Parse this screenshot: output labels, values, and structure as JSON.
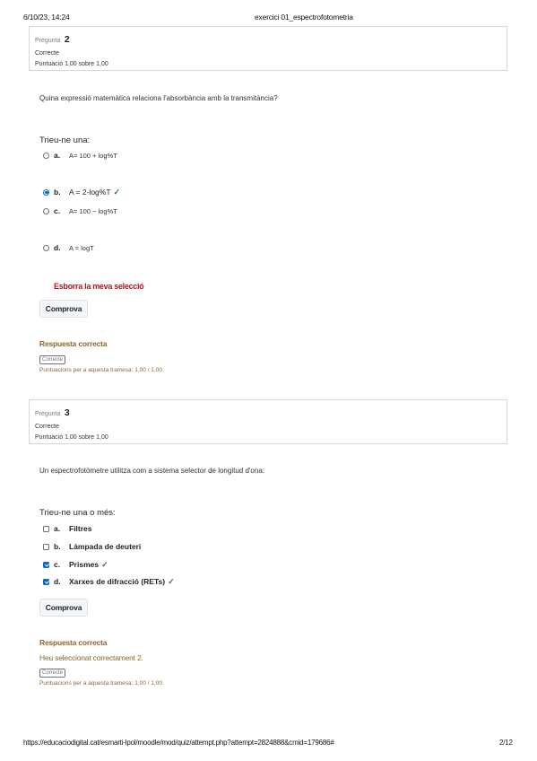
{
  "print_header": {
    "datetime": "6/10/23, 14:24",
    "doc_title": "exercici 01_espectrofotometria"
  },
  "print_footer": {
    "url": "https://educaciodigital.cat/esmarti-lpol/moodle/mod/quiz/attempt.php?attempt=2824888&cmid=179686#",
    "page": "2/12"
  },
  "q2": {
    "label": "Pregunta",
    "number": "2",
    "state": "Correcte",
    "grade": "Puntuació 1,00 sobre 1,00",
    "text": "Quina expressió matemàtica relaciona l'absorbància amb la transmitància?",
    "prompt": "Trieu-ne una:",
    "options": [
      {
        "letter": "a.",
        "text": "A= 100 + log%T",
        "selected": false
      },
      {
        "letter": "b.",
        "text": "A = 2-log%T",
        "selected": true,
        "correct_icon": "check-icon"
      },
      {
        "letter": "c.",
        "text": "A= 100 − log%T",
        "selected": false
      },
      {
        "letter": "d.",
        "text": "A = logT",
        "selected": false
      }
    ],
    "clear_label": "Esborra la meva selecció",
    "check_label": "Comprova",
    "feedback_title": "Respuesta correcta",
    "badge": "Correcte",
    "marks": "Puntuacions per a aquesta tramesa: 1,00 / 1,00."
  },
  "q3": {
    "label": "Pregunta",
    "number": "3",
    "state": "Correcte",
    "grade": "Puntuació 1,00 sobre 1,00",
    "text": "Un espectrofotòmetre utilitza com a sistema selector de longitud d'ona:",
    "prompt": "Trieu-ne una o més:",
    "options": [
      {
        "letter": "a.",
        "text": "Filtres",
        "selected": false
      },
      {
        "letter": "b.",
        "text": "Làmpada de deuteri",
        "selected": false
      },
      {
        "letter": "c.",
        "text": "Prismes",
        "selected": true,
        "correct_icon": "check-icon"
      },
      {
        "letter": "d.",
        "text": "Xarxes de difracció (RETs)",
        "selected": true,
        "correct_icon": "check-icon"
      }
    ],
    "check_label": "Comprova",
    "feedback_title": "Respuesta correcta",
    "feedback_extra": "Heu seleccionat correctament 2.",
    "badge": "Correcte",
    "marks": "Puntuacions per a aquesta tramesa: 1,00 / 1,00."
  },
  "colors": {
    "correct": "#357a32",
    "feedback": "#8e662e",
    "clear_link": "#b8151d",
    "selected": "#0f6cbf"
  }
}
